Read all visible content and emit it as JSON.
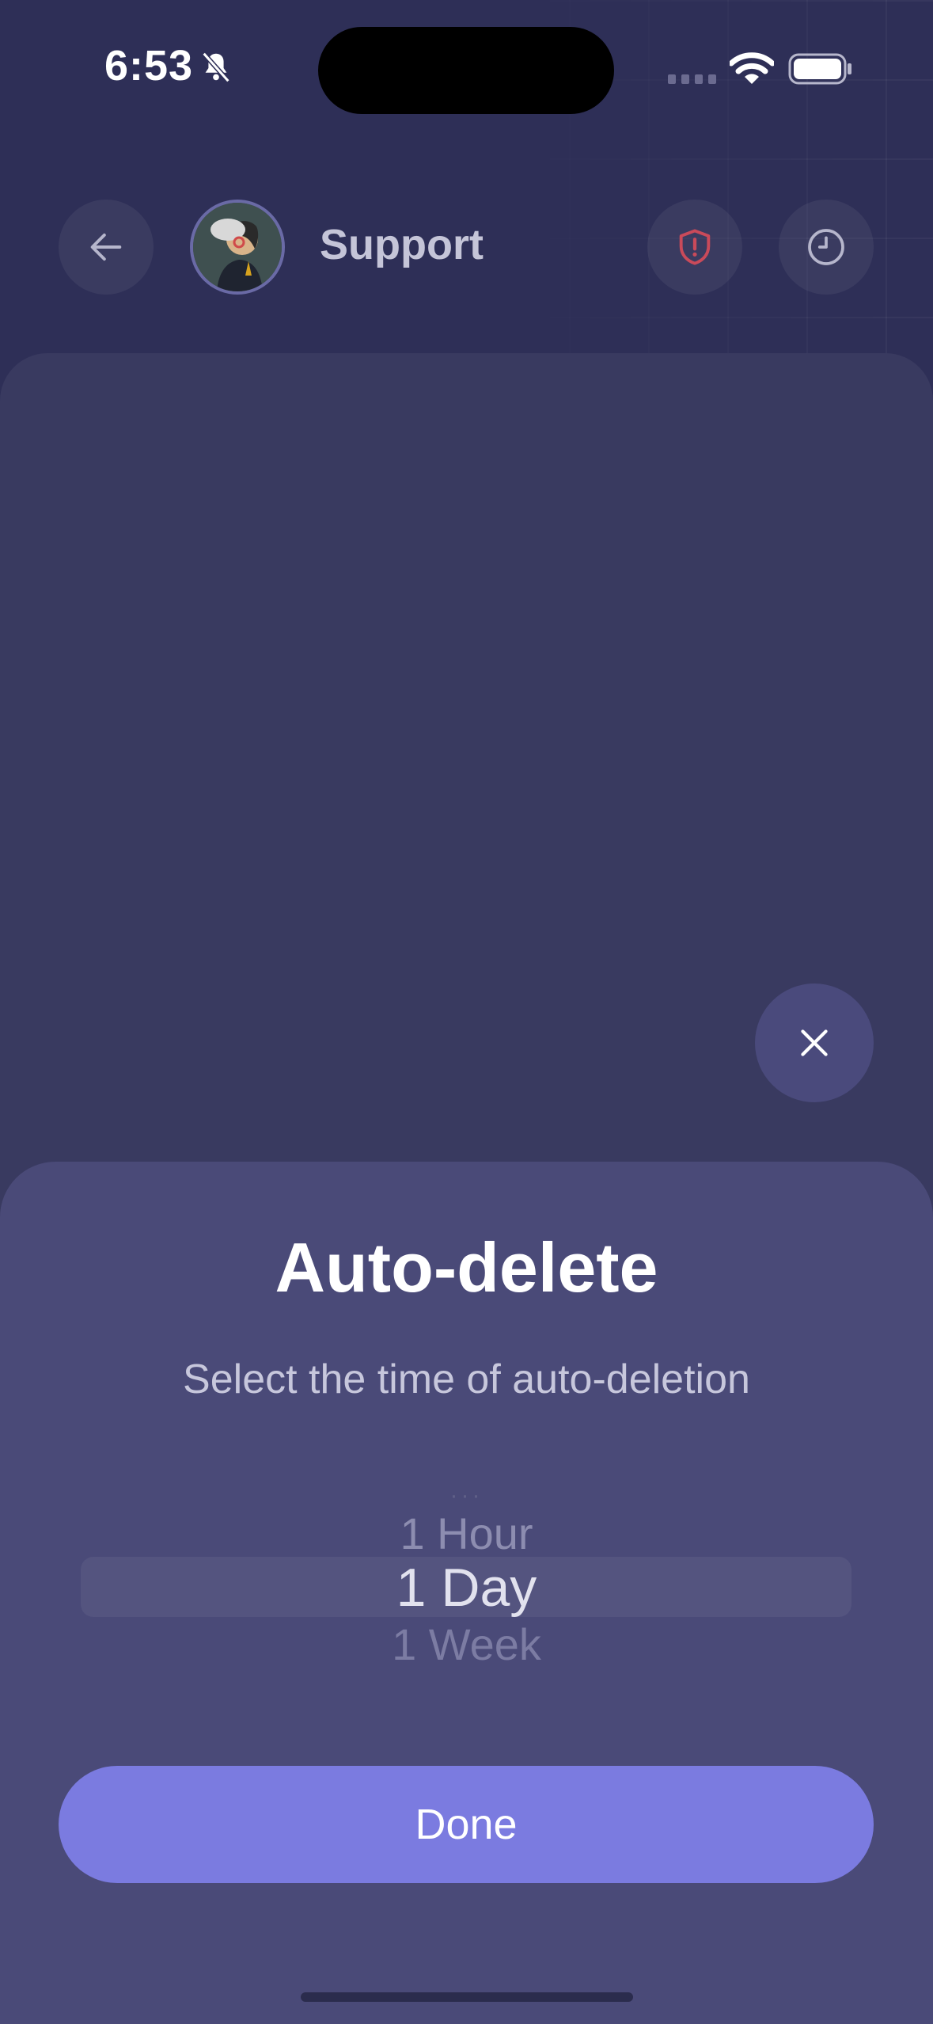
{
  "status_bar": {
    "time": "6:53"
  },
  "header": {
    "title": "Support"
  },
  "sheet": {
    "title": "Auto-delete",
    "subtitle": "Select the time of auto-deletion",
    "picker": {
      "options_visible": [
        "1 Hour",
        "1 Day",
        "1 Week"
      ],
      "selected": "1 Day"
    },
    "done_label": "Done"
  },
  "colors": {
    "background": "#2e2f57",
    "sheet": "#4a4a78",
    "accent": "#7b7be0",
    "warning": "#c94a5a"
  },
  "icons": {
    "back": "arrow-left-icon",
    "alert": "shield-alert-icon",
    "timer": "clock-icon",
    "close": "close-icon",
    "mute": "bell-slash-icon"
  }
}
